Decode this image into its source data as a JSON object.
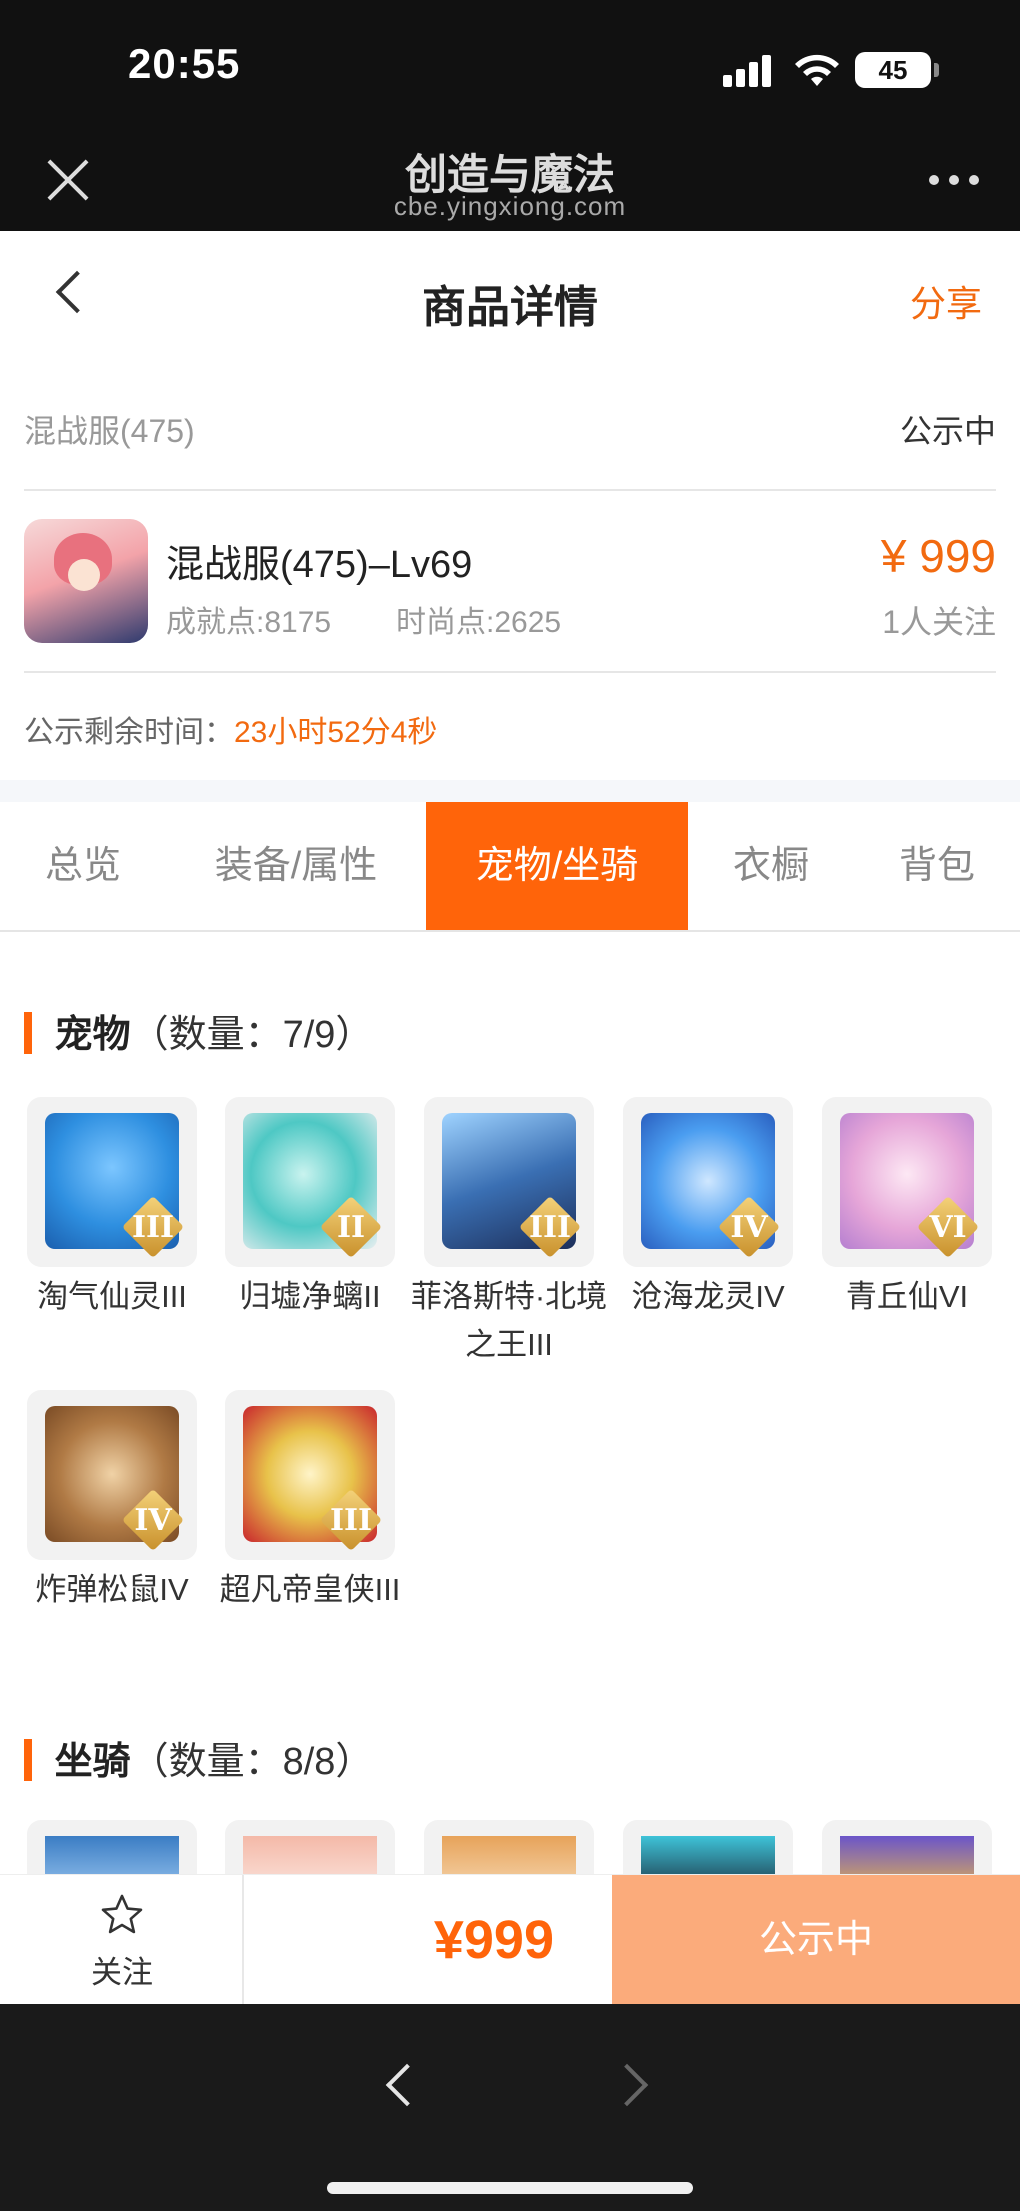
{
  "status_bar": {
    "time": "20:55",
    "battery": "45"
  },
  "browser": {
    "title": "创造与魔法",
    "url": "cbe.yingxiong.com"
  },
  "header": {
    "title": "商品详情",
    "share_label": "分享"
  },
  "server": {
    "name": "混战服(475)",
    "status": "公示中"
  },
  "product": {
    "name": "混战服(475)–Lv69",
    "achievement": "成就点:8175",
    "fashion": "时尚点:2625",
    "price": "¥ 999",
    "followers": "1人关注"
  },
  "countdown": {
    "label": "公示剩余时间：",
    "value": "23小时52分4秒"
  },
  "tabs": [
    {
      "label": "总览",
      "active": false
    },
    {
      "label": "装备/属性",
      "active": false
    },
    {
      "label": "宠物/坐骑",
      "active": true
    },
    {
      "label": "衣橱",
      "active": false
    },
    {
      "label": "背包",
      "active": false
    }
  ],
  "pets_section": {
    "title": "宠物",
    "count": "（数量：7/9）"
  },
  "pets": [
    {
      "name": "淘气仙灵III",
      "rank": "III",
      "icon": "blue-dog-pet-icon",
      "color": "#2e8fe0"
    },
    {
      "name": "归墟净螭II",
      "rank": "II",
      "icon": "teal-dragon-pet-icon",
      "color": "#4ec8c4"
    },
    {
      "name": "菲洛斯特·北境之王III",
      "rank": "III",
      "icon": "ice-king-pet-icon",
      "color": "#3a6fb3"
    },
    {
      "name": "沧海龙灵IV",
      "rank": "IV",
      "icon": "sea-dragon-spirit-icon",
      "color": "#4a9df0"
    },
    {
      "name": "青丘仙VI",
      "rank": "VI",
      "icon": "fox-fairy-pet-icon",
      "color": "#e6a6d8"
    },
    {
      "name": "炸弹松鼠IV",
      "rank": "IV",
      "icon": "bomb-squirrel-pet-icon",
      "color": "#b07a45"
    },
    {
      "name": "超凡帝皇侠III",
      "rank": "III",
      "icon": "golden-emperor-pet-icon",
      "color": "#e8c24a"
    }
  ],
  "mounts_section": {
    "title": "坐骑",
    "count": "（数量：8/8）"
  },
  "mounts_preview": [
    {
      "icon": "blue-mount-icon",
      "color": "#3b7dc4"
    },
    {
      "icon": "pink-mount-icon",
      "color": "#f4b9a8"
    },
    {
      "icon": "orange-mount-icon",
      "color": "#e7a35a"
    },
    {
      "icon": "cyan-mount-icon",
      "color": "#3ec3d8"
    },
    {
      "icon": "purple-mount-icon",
      "color": "#6b55c9"
    }
  ],
  "action_bar": {
    "follow_label": "关注",
    "price": "¥999",
    "status_label": "公示中"
  },
  "colors": {
    "accent": "#ff640a",
    "status_button": "#fbab7b"
  }
}
